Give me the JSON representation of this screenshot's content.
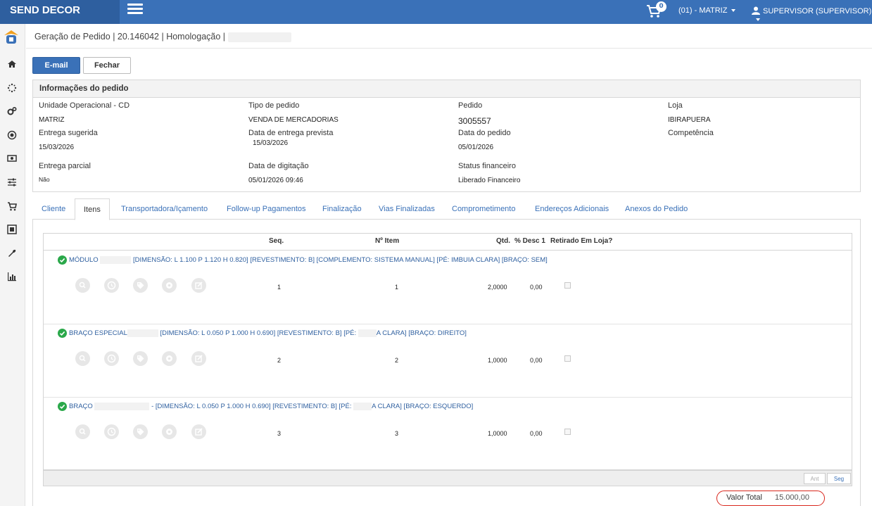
{
  "app": {
    "brand": "SEND DECOR",
    "cart_count": "0",
    "store": "(01) - MATRIZ",
    "user": "SUPERVISOR (SUPERVISOR)"
  },
  "icons": [
    "menu-icon",
    "cart-icon",
    "caret-down-icon",
    "user-icon",
    "logo-icon",
    "home-icon",
    "spinner-icon",
    "cogs-icon",
    "target-icon",
    "money-icon",
    "sliders-icon",
    "cart-icon",
    "image-icon",
    "wrench-icon",
    "bar-chart-icon",
    "check-circle-icon",
    "search-icon",
    "history-icon",
    "tag-icon",
    "gear-icon",
    "edit-icon"
  ],
  "breadcrumb": "Geração de Pedido | 20.146042 | Homologação |",
  "toolbar": {
    "email": "E-mail",
    "close": "Fechar"
  },
  "info": {
    "title": "Informações do pedido",
    "fields": [
      {
        "label": "Unidade Operacional - CD",
        "value": "MATRIZ"
      },
      {
        "label": "Tipo de pedido",
        "value": "VENDA DE MERCADORIAS"
      },
      {
        "label": "Pedido",
        "value": "3005557"
      },
      {
        "label": "Loja",
        "value": "IBIRAPUERA"
      },
      {
        "label": "Entrega sugerida",
        "value": "15/03/2026"
      },
      {
        "label": "Data de entrega prevista",
        "value": "15/03/2026"
      },
      {
        "label": "Data do pedido",
        "value": "05/01/2026"
      },
      {
        "label": "Competência",
        "value": ""
      },
      {
        "label": "Entrega parcial",
        "value": "Não"
      },
      {
        "label": "Data de digitação",
        "value": "05/01/2026 09:46"
      },
      {
        "label": "Status financeiro",
        "value": "Liberado Financeiro"
      }
    ]
  },
  "tabs": [
    "Cliente",
    "Itens",
    "Transportadora/Içamento",
    "Follow-up Pagamentos",
    "Finalização",
    "Vias Finalizadas",
    "Comprometimento",
    "Endereços Adicionais",
    "Anexos do Pedido"
  ],
  "grid": {
    "headers": {
      "seq": "Seq.",
      "item": "Nº Item",
      "qty": "Qtd.",
      "desc": "% Desc 1",
      "pickup": "Retirado Em Loja?"
    },
    "rows": [
      {
        "name": "MÓDULO",
        "spec": "[DIMENSÃO: L 1.100 P 1.120 H 0.820] [REVESTIMENTO: B] [COMPLEMENTO: SISTEMA MANUAL] [PÉ: IMBUIA CLARA] [BRAÇO: SEM]",
        "seq": "1",
        "item": "1",
        "qty": "2,0000",
        "desc": "0,00"
      },
      {
        "name": "BRAÇO ESPECIAL",
        "spec": "[DIMENSÃO: L 0.050 P 1.000 H 0.690] [REVESTIMENTO: B] [PÉ:",
        "spec2": "A CLARA] [BRAÇO: DIREITO]",
        "seq": "2",
        "item": "2",
        "qty": "1,0000",
        "desc": "0,00"
      },
      {
        "name": "BRAÇO",
        "spec": "- [DIMENSÃO: L 0.050 P 1.000 H 0.690] [REVESTIMENTO: B] [PÉ:",
        "spec2": "A CLARA] [BRAÇO: ESQUERDO]",
        "seq": "3",
        "item": "3",
        "qty": "1,0000",
        "desc": "0,00"
      }
    ],
    "pager": {
      "prev": "Ant",
      "next": "Seg"
    }
  },
  "total": {
    "label": "Valor Total",
    "value": "15.000,00"
  },
  "colors": {
    "primary": "#3a71b8",
    "highlight": "#d9261c",
    "check": "#2aa84a"
  }
}
